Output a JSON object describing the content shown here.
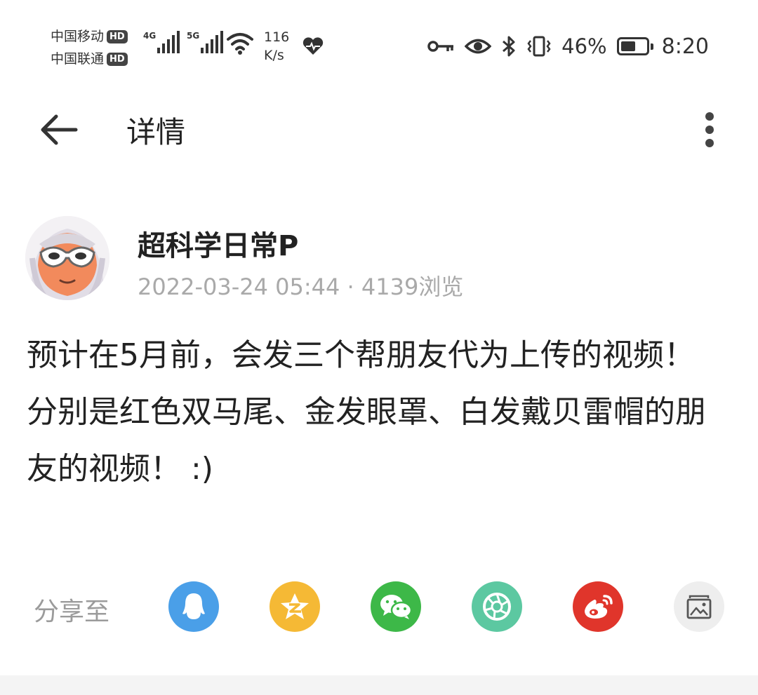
{
  "status_bar": {
    "carrier_1": "中国移动",
    "carrier_2": "中国联通",
    "hd_badge": "HD",
    "net_1": "4G",
    "net_2": "5G",
    "speed_value": "116",
    "speed_unit": "K/s",
    "battery_percent": "46%",
    "battery_level": 0.46,
    "time": "8:20"
  },
  "header": {
    "title": "详情",
    "back_icon": "arrow-left-icon",
    "more_icon": "more-vertical-icon"
  },
  "post": {
    "author": "超科学日常P",
    "meta": "2022-03-24 05:44 · 4139浏览",
    "body": "预计在5月前，会发三个帮朋友代为上传的视频！\n分别是红色双马尾、金发眼罩、白发戴贝雷帽的朋友的视频！ :)"
  },
  "share": {
    "label": "分享至",
    "targets": [
      {
        "name": "qq",
        "icon": "qq-penguin-icon",
        "color": "#4a9fe8"
      },
      {
        "name": "qzone",
        "icon": "qzone-star-icon",
        "color": "#f5b935"
      },
      {
        "name": "wechat",
        "icon": "wechat-icon",
        "color": "#3db848"
      },
      {
        "name": "moments",
        "icon": "moments-shutter-icon",
        "color": "#5cc8a1"
      },
      {
        "name": "weibo",
        "icon": "weibo-icon",
        "color": "#e0352b"
      },
      {
        "name": "image",
        "icon": "image-share-icon",
        "color": "#eeeeee"
      }
    ]
  }
}
